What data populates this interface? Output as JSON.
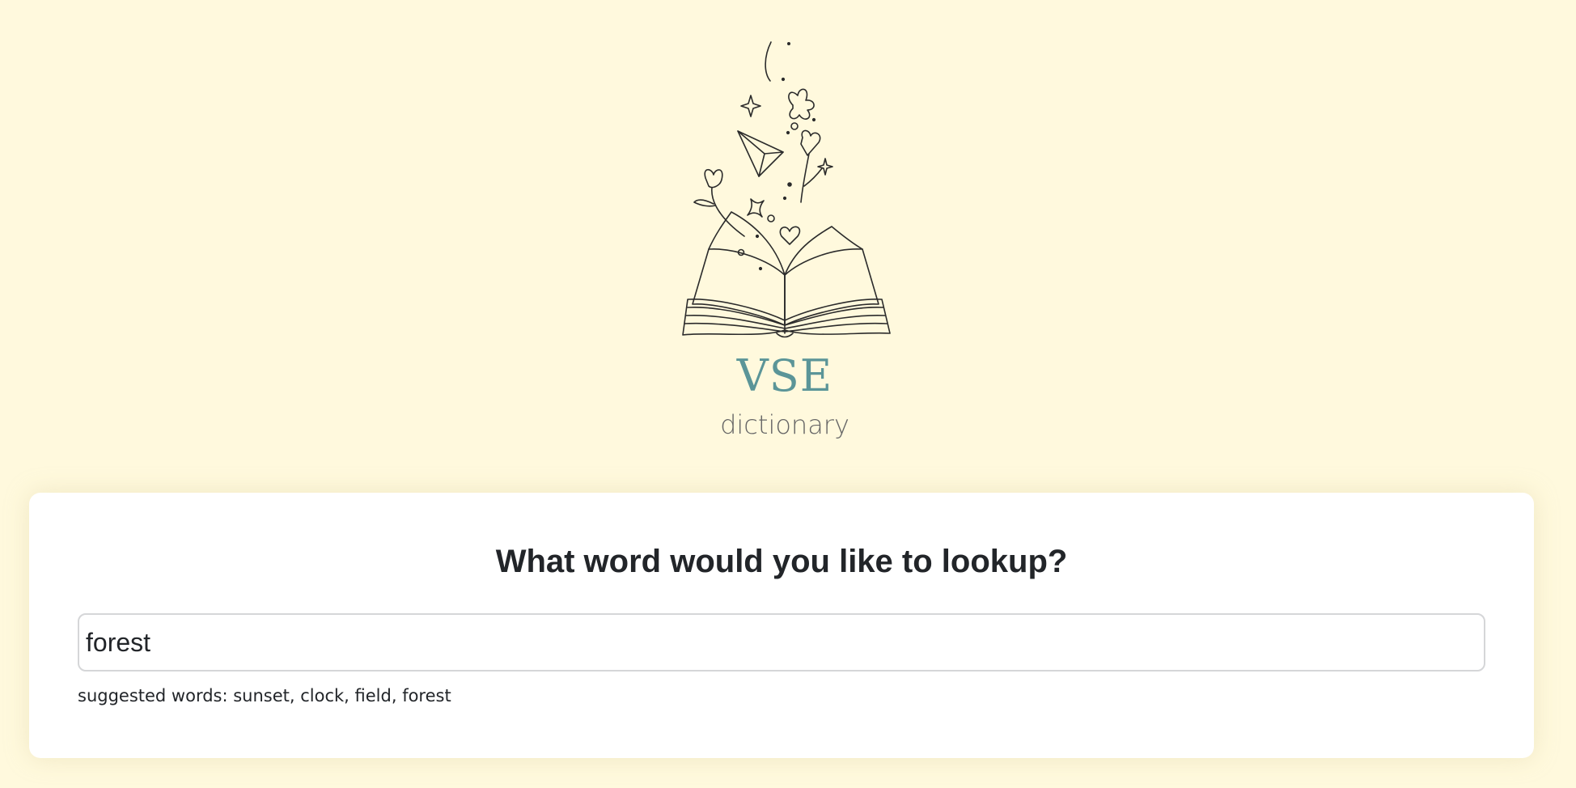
{
  "logo": {
    "title": "VSE",
    "subtitle": "dictionary",
    "illustration_icon": "open-book-doodle-icon"
  },
  "search": {
    "heading": "What word would you like to lookup?",
    "value": "forest",
    "suggestions_text": "suggested words: sunset, clock, field, forest"
  },
  "colors": {
    "page_background": "#fff9dd",
    "brand_teal": "#5b9598",
    "card_background": "#ffffff",
    "text_dark": "#222529"
  }
}
